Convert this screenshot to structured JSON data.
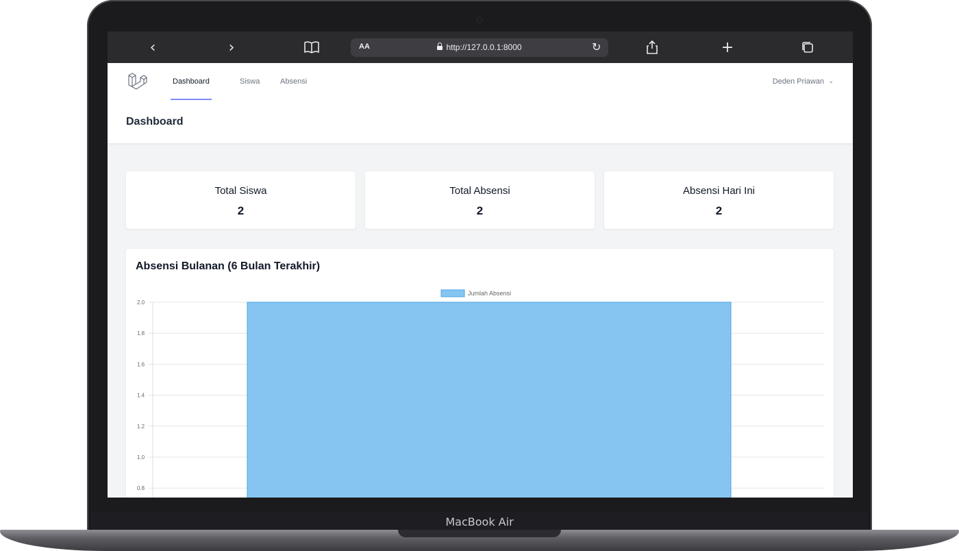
{
  "device": {
    "label": "MacBook Air"
  },
  "browser": {
    "reader_label": "AA",
    "url": "http://127.0.0.1:8000"
  },
  "nav": {
    "links": [
      "Dashboard",
      "Siswa",
      "Absensi"
    ],
    "user": "Deden Priawan"
  },
  "header": {
    "title": "Dashboard"
  },
  "stats": [
    {
      "title": "Total Siswa",
      "value": "2"
    },
    {
      "title": "Total Absensi",
      "value": "2"
    },
    {
      "title": "Absensi Hari Ini",
      "value": "2"
    }
  ],
  "chart_section": {
    "title": "Absensi Bulanan (6 Bulan Terakhir)"
  },
  "chart_data": {
    "type": "bar",
    "series": [
      {
        "name": "Jumlah Absensi",
        "values": [
          2
        ]
      }
    ],
    "values": [
      2
    ],
    "y_ticks": [
      "2.0",
      "1.8",
      "1.6",
      "1.4",
      "1.2",
      "1.0",
      "0.8"
    ],
    "ylim_visible": [
      0.8,
      2.0
    ],
    "grid": true,
    "legend": "top-center",
    "colors": {
      "bar_fill": "#86c5f1",
      "bar_border": "#4aa2e0"
    }
  }
}
